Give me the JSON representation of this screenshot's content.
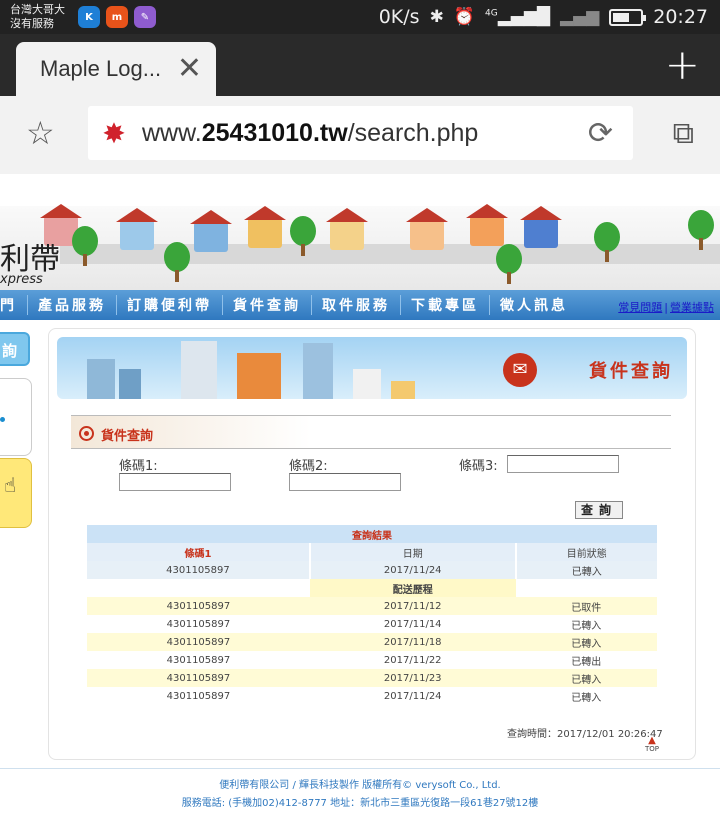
{
  "status_bar": {
    "carrier_line1": "台灣大哥大",
    "carrier_line2": "沒有服務",
    "app_icons": [
      "K",
      "m",
      "✎"
    ],
    "app_colors": [
      "#1e7fd6",
      "#e8531a",
      "#8f5ccf"
    ],
    "net_speed": "0K/s",
    "network": "4G",
    "time": "20:27",
    "battery_level": 0.6
  },
  "browser": {
    "tab_title": "Maple Log...",
    "url_prefix": "www.",
    "url_bold": "25431010.tw",
    "url_suffix": "/search.php"
  },
  "site": {
    "logo_text": "利帶",
    "logo_sub": "xpress",
    "nav_items": [
      "門",
      "產品服務",
      "訂購便利帶",
      "貨件查詢",
      "取件服務",
      "下載專區",
      "徵人訊息"
    ],
    "nav_links": [
      "常見問題",
      "營業據點"
    ],
    "sidebar_label": "詢"
  },
  "content": {
    "hero_title": "貨件查詢",
    "section_title": "貨件查詢",
    "fields": [
      {
        "label": "條碼1:",
        "value": ""
      },
      {
        "label": "條碼2:",
        "value": ""
      },
      {
        "label": "條碼3:",
        "value": ""
      }
    ],
    "query_button": "查詢",
    "result": {
      "title": "查詢結果",
      "headers": [
        "條碼1",
        "日期",
        "目前狀態"
      ],
      "summary": [
        "4301105897",
        "2017/11/24",
        "已轉入"
      ],
      "history_title": "配送歷程",
      "history": [
        [
          "4301105897",
          "2017/11/12",
          "已取件"
        ],
        [
          "4301105897",
          "2017/11/14",
          "已轉入"
        ],
        [
          "4301105897",
          "2017/11/18",
          "已轉入"
        ],
        [
          "4301105897",
          "2017/11/22",
          "已轉出"
        ],
        [
          "4301105897",
          "2017/11/23",
          "已轉入"
        ],
        [
          "4301105897",
          "2017/11/24",
          "已轉入"
        ]
      ]
    },
    "query_time": "查詢時間：2017/12/01 20:26:47",
    "top_label": "TOP"
  },
  "footer": {
    "line1": "便利帶有限公司 / 輝長科技製作 版權所有© verysoft Co., Ltd.",
    "line2": "服務電話: (手機加02)412-8777 地址：新北市三重區光復路一段61巷27號12樓"
  }
}
